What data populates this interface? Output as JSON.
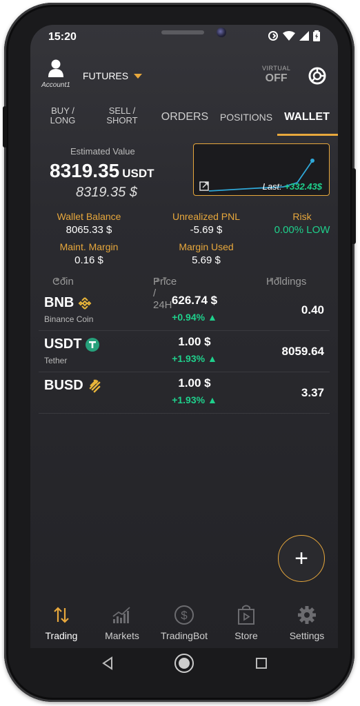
{
  "status": {
    "time": "15:20"
  },
  "header": {
    "account_label": "Account1",
    "mode_label": "FUTURES",
    "virtual_label": "VIRTUAL",
    "virtual_value": "OFF"
  },
  "tabs": [
    {
      "line1": "BUY /",
      "line2": "LONG"
    },
    {
      "line1": "SELL /",
      "line2": "SHORT"
    },
    {
      "label": "ORDERS"
    },
    {
      "label": "POSITIONS"
    },
    {
      "label": "WALLET",
      "active": true
    }
  ],
  "estimate": {
    "label": "Estimated Value",
    "value": "8319.35",
    "unit": "USDT",
    "usd_value": "8319.35 $",
    "last_label": "Last:",
    "last_value": "+332.43$"
  },
  "stats": {
    "wallet_balance_label": "Wallet Balance",
    "wallet_balance_value": "8065.33 $",
    "unrealized_pnl_label": "Unrealized PNL",
    "unrealized_pnl_value": "-5.69 $",
    "risk_label": "Risk",
    "risk_value": "0.00% LOW",
    "maint_margin_label": "Maint. Margin",
    "maint_margin_value": "0.16 $",
    "margin_used_label": "Margin Used",
    "margin_used_value": "5.69 $"
  },
  "table": {
    "headers": {
      "coin": "Coin",
      "price": "Price / 24H",
      "holdings": "Holdings"
    },
    "rows": [
      {
        "symbol": "BNB",
        "name": "Binance Coin",
        "price": "626.74 $",
        "change": "+0.94% ▲",
        "holdings": "0.40"
      },
      {
        "symbol": "USDT",
        "name": "Tether",
        "price": "1.00 $",
        "change": "+1.93% ▲",
        "holdings": "8059.64"
      },
      {
        "symbol": "BUSD",
        "name": "",
        "price": "1.00 $",
        "change": "+1.93% ▲",
        "holdings": "3.37"
      }
    ]
  },
  "fab_label": "+",
  "nav": [
    {
      "label": "Trading",
      "icon": "arrows-up-down-icon",
      "active": true
    },
    {
      "label": "Markets",
      "icon": "bar-chart-icon"
    },
    {
      "label": "TradingBot",
      "icon": "dollar-circle-icon"
    },
    {
      "label": "Store",
      "icon": "store-bag-icon"
    },
    {
      "label": "Settings",
      "icon": "gear-icon"
    }
  ],
  "colors": {
    "accent": "#e8a83c",
    "positive": "#1fd08c",
    "background": "#2b2b30"
  }
}
